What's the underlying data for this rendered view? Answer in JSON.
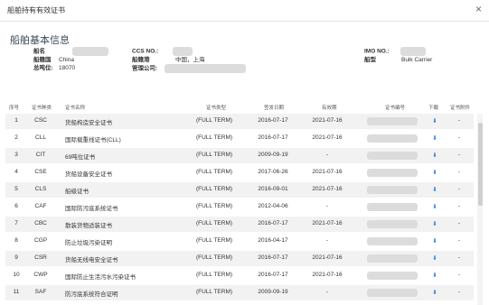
{
  "dialog": {
    "title": "船舶持有有效证书",
    "close": "×"
  },
  "basic": {
    "title": "船舶基本信息",
    "name_label": "船名",
    "flag_label": "船籍国",
    "flag_value": "China",
    "gt_label": "总吨位:",
    "gt_value": "18070",
    "ccs_label": "CCS NO.:",
    "port_label": "船籍港",
    "port_value": "中国，上海",
    "company_label": "管理公司:",
    "imo_label": "IMO NO.:",
    "type_label": "船型",
    "type_value": "Bulk Carrier"
  },
  "table": {
    "headers": [
      "序号",
      "证书种类",
      "证书名称",
      "证书类型",
      "签发日期",
      "有效期",
      "证书编号",
      "下载",
      "证书附件"
    ],
    "rows": [
      {
        "num": "1",
        "code": "CSC",
        "name": "货船构造安全证书",
        "type": "(FULL TERM)",
        "issue": "2016-07-17",
        "valid": "2021-07-16",
        "dl": "⬇",
        "att": "-"
      },
      {
        "num": "2",
        "code": "CLL",
        "name": "国际载重线证书(CLL)",
        "type": "(FULL TERM)",
        "issue": "2016-07-17",
        "valid": "2021-07-16",
        "dl": "⬇",
        "att": "-"
      },
      {
        "num": "3",
        "code": "CIT",
        "name": "69吨位证书",
        "type": "(FULL TERM)",
        "issue": "2009-09-19",
        "valid": "-",
        "dl": "⬇",
        "att": "-"
      },
      {
        "num": "4",
        "code": "CSE",
        "name": "货船设备安全证书",
        "type": "(FULL TERM)",
        "issue": "2017-06-26",
        "valid": "2021-07-16",
        "dl": "⬇",
        "att": "-"
      },
      {
        "num": "5",
        "code": "CLS",
        "name": "船级证书",
        "type": "(FULL TERM)",
        "issue": "2016-09-01",
        "valid": "2021-07-16",
        "dl": "⬇",
        "att": "-"
      },
      {
        "num": "6",
        "code": "CAF",
        "name": "国际防污底系统证书",
        "type": "(FULL TERM)",
        "issue": "2012-04-06",
        "valid": "-",
        "dl": "⬇",
        "att": "-"
      },
      {
        "num": "7",
        "code": "CBC",
        "name": "散装货物适装证书",
        "type": "(FULL TERM)",
        "issue": "2016-07-17",
        "valid": "2021-07-16",
        "dl": "⬇",
        "att": "-"
      },
      {
        "num": "8",
        "code": "CGP",
        "name": "防止垃圾污染证明",
        "type": "(FULL TERM)",
        "issue": "2016-04-17",
        "valid": "-",
        "dl": "⬇",
        "att": "-"
      },
      {
        "num": "9",
        "code": "CSR",
        "name": "货船无线电安全证书",
        "type": "(FULL TERM)",
        "issue": "2016-07-17",
        "valid": "2021-07-16",
        "dl": "⬇",
        "att": "-"
      },
      {
        "num": "10",
        "code": "CWP",
        "name": "国际防止生活污水污染证书",
        "type": "(FULL TERM)",
        "issue": "2016-07-17",
        "valid": "2021-07-16",
        "dl": "⬇",
        "att": "-"
      },
      {
        "num": "11",
        "code": "SAF",
        "name": "防污底系统符合证明",
        "type": "(FULL TERM)",
        "issue": "2009-09-19",
        "valid": "-",
        "dl": "⬇",
        "att": "-"
      }
    ]
  },
  "colors": {
    "accent": "#2b7fd0",
    "alt_row": "#f2f2f2"
  }
}
